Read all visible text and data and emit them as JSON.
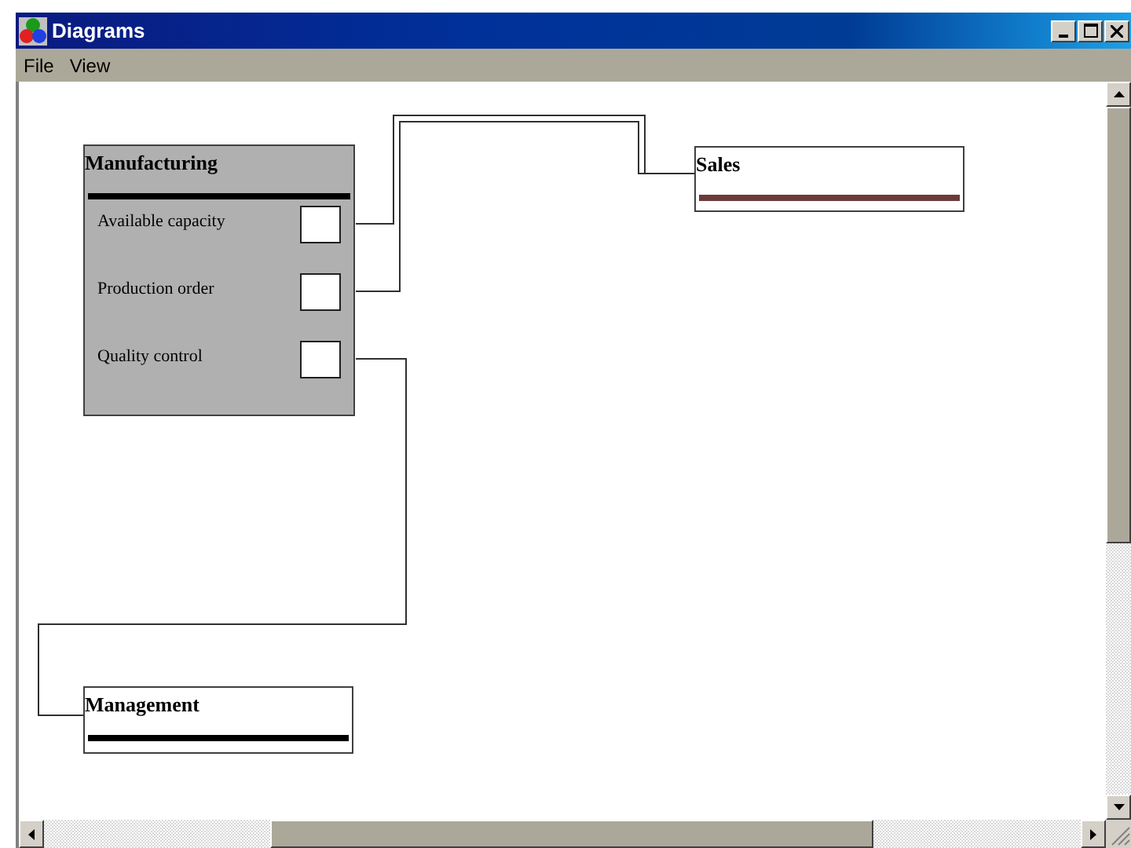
{
  "window": {
    "title": "Diagrams"
  },
  "menu": [
    "File",
    "View"
  ],
  "nodes": [
    {
      "title": "Manufacturing",
      "kind": "container",
      "color": "#000000",
      "fields": [
        "Available capacity",
        "Production order",
        "Quality control"
      ]
    },
    {
      "title": "Sales",
      "kind": "simple",
      "color": "#6b3b3b"
    },
    {
      "title": "Management",
      "kind": "simple",
      "color": "#000000"
    }
  ]
}
